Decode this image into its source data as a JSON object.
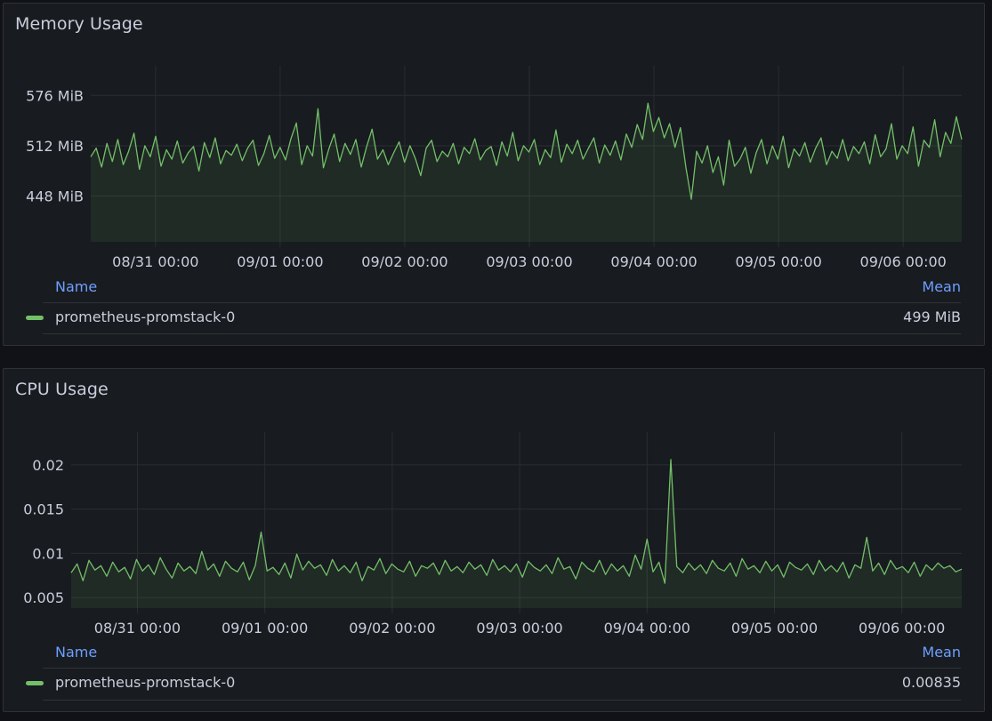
{
  "colors": {
    "series": "#73bf69",
    "legend_header": "#6e9fff"
  },
  "panels": {
    "memory": {
      "title": "Memory Usage",
      "legend": {
        "name_header": "Name",
        "value_header": "Mean",
        "series_name": "prometheus-promstack-0",
        "series_value": "499 MiB"
      }
    },
    "cpu": {
      "title": "CPU Usage",
      "legend": {
        "name_header": "Name",
        "value_header": "Mean",
        "series_name": "prometheus-promstack-0",
        "series_value": "0.00835"
      }
    }
  },
  "chart_data": [
    {
      "type": "area",
      "title": "Memory Usage",
      "xlabel": "",
      "ylabel": "",
      "unit": "MiB",
      "ylim": [
        390,
        600
      ],
      "yticks": [
        448,
        512,
        576
      ],
      "ytick_labels": [
        "448 MiB",
        "512 MiB",
        "576 MiB"
      ],
      "x_range_days": [
        -0.52,
        6.47
      ],
      "xtick_labels": [
        "08/31 00:00",
        "09/01 00:00",
        "09/02 00:00",
        "09/03 00:00",
        "09/04 00:00",
        "09/05 00:00",
        "09/06 00:00"
      ],
      "xtick_positions_days": [
        0,
        1,
        2,
        3,
        4,
        5,
        6
      ],
      "grid": true,
      "legend_placement": "bottom",
      "series": [
        {
          "name": "prometheus-promstack-0",
          "mean": 499,
          "values": [
            498,
            509,
            485,
            515,
            492,
            520,
            488,
            505,
            528,
            482,
            512,
            498,
            524,
            486,
            507,
            495,
            518,
            490,
            503,
            511,
            480,
            516,
            497,
            522,
            489,
            506,
            500,
            514,
            493,
            509,
            519,
            487,
            502,
            525,
            496,
            510,
            494,
            521,
            541,
            488,
            512,
            499,
            559,
            484,
            508,
            527,
            492,
            515,
            501,
            520,
            485,
            511,
            533,
            495,
            507,
            488,
            503,
            517,
            491,
            512,
            496,
            474,
            509,
            519,
            492,
            505,
            498,
            515,
            489,
            510,
            502,
            521,
            494,
            506,
            511,
            487,
            517,
            499,
            529,
            493,
            512,
            504,
            520,
            488,
            507,
            497,
            532,
            491,
            514,
            502,
            519,
            495,
            509,
            522,
            490,
            513,
            500,
            518,
            494,
            527,
            510,
            539,
            520,
            566,
            530,
            548,
            522,
            540,
            510,
            535,
            485,
            444,
            505,
            490,
            512,
            478,
            498,
            462,
            519,
            486,
            495,
            510,
            477,
            503,
            520,
            489,
            512,
            495,
            524,
            484,
            508,
            499,
            516,
            491,
            509,
            522,
            488,
            505,
            496,
            520,
            493,
            511,
            502,
            517,
            489,
            526,
            498,
            508,
            540,
            495,
            512,
            502,
            536,
            486,
            519,
            510,
            545,
            498,
            529,
            515,
            549,
            520
          ]
        }
      ]
    },
    {
      "type": "area",
      "title": "CPU Usage",
      "xlabel": "",
      "ylabel": "",
      "ylim": [
        0.0038,
        0.0225
      ],
      "yticks": [
        0.005,
        0.01,
        0.015,
        0.02
      ],
      "ytick_labels": [
        "0.005",
        "0.01",
        "0.015",
        "0.02"
      ],
      "x_range_days": [
        -0.52,
        6.47
      ],
      "xtick_labels": [
        "08/31 00:00",
        "09/01 00:00",
        "09/02 00:00",
        "09/03 00:00",
        "09/04 00:00",
        "09/05 00:00",
        "09/06 00:00"
      ],
      "xtick_positions_days": [
        0,
        1,
        2,
        3,
        4,
        5,
        6
      ],
      "grid": true,
      "legend_placement": "bottom",
      "series": [
        {
          "name": "prometheus-promstack-0",
          "mean": 0.00835,
          "values": [
            0.0078,
            0.0088,
            0.0069,
            0.0092,
            0.0081,
            0.0086,
            0.0074,
            0.009,
            0.0079,
            0.0084,
            0.0071,
            0.0093,
            0.008,
            0.0087,
            0.0076,
            0.0095,
            0.0082,
            0.0072,
            0.0089,
            0.008,
            0.0085,
            0.0077,
            0.0102,
            0.0081,
            0.0088,
            0.0074,
            0.0091,
            0.0083,
            0.0079,
            0.009,
            0.007,
            0.0086,
            0.0124,
            0.008,
            0.0084,
            0.0076,
            0.0089,
            0.0072,
            0.0099,
            0.0081,
            0.0091,
            0.0083,
            0.0087,
            0.0075,
            0.0093,
            0.008,
            0.0086,
            0.0078,
            0.009,
            0.0069,
            0.0085,
            0.0081,
            0.0094,
            0.0077,
            0.0088,
            0.0082,
            0.0079,
            0.0091,
            0.0074,
            0.0086,
            0.0083,
            0.0089,
            0.0076,
            0.0092,
            0.008,
            0.0085,
            0.0078,
            0.009,
            0.0082,
            0.0087,
            0.0075,
            0.0093,
            0.0081,
            0.0086,
            0.0079,
            0.0088,
            0.0073,
            0.0091,
            0.0084,
            0.008,
            0.0087,
            0.0077,
            0.0095,
            0.0082,
            0.0085,
            0.0071,
            0.009,
            0.0083,
            0.0079,
            0.0092,
            0.0076,
            0.0088,
            0.008,
            0.0086,
            0.0074,
            0.0098,
            0.0082,
            0.0116,
            0.0079,
            0.009,
            0.0066,
            0.0206,
            0.0085,
            0.0078,
            0.0089,
            0.0081,
            0.0087,
            0.0077,
            0.0092,
            0.0083,
            0.008,
            0.0089,
            0.0074,
            0.0094,
            0.0082,
            0.0086,
            0.0078,
            0.0091,
            0.008,
            0.0087,
            0.0073,
            0.009,
            0.0084,
            0.0081,
            0.0088,
            0.0076,
            0.0092,
            0.008,
            0.0086,
            0.0079,
            0.009,
            0.0072,
            0.0087,
            0.0083,
            0.0118,
            0.008,
            0.0089,
            0.0076,
            0.0092,
            0.0082,
            0.0085,
            0.0078,
            0.009,
            0.0074,
            0.0087,
            0.0081,
            0.0089,
            0.0083,
            0.0086,
            0.0079,
            0.0082
          ]
        }
      ]
    }
  ]
}
